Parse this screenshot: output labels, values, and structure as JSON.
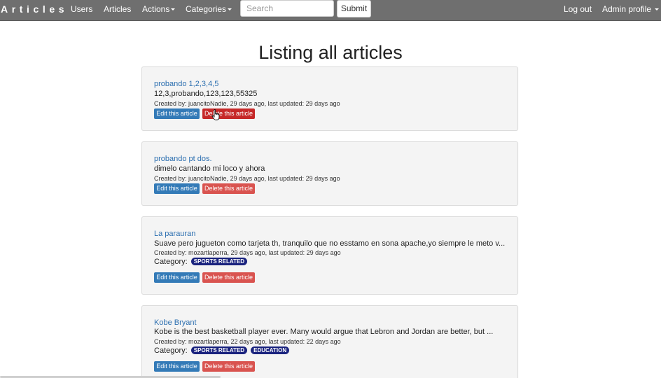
{
  "navbar": {
    "brand": "Articles",
    "links": {
      "users": "Users",
      "articles": "Articles",
      "actions": "Actions",
      "categories": "Categories",
      "logout": "Log out",
      "admin_profile": "Admin profile"
    },
    "search": {
      "placeholder": "Search",
      "value": ""
    },
    "submit_label": "Submit"
  },
  "page": {
    "title": "Listing all articles"
  },
  "labels": {
    "edit": "Edit this article",
    "delete": "Delete this article",
    "category": "Category:"
  },
  "articles": [
    {
      "title": "probando 1,2,3,4,5",
      "description": "12,3,probando,123,123,55325",
      "meta": "Created by: juancitoNadie, 29 days ago, last updated: 29 days ago",
      "categories": []
    },
    {
      "title": "probando pt dos.",
      "description": "dimelo cantando mi loco y ahora",
      "meta": "Created by: juancitoNadie, 29 days ago, last updated: 29 days ago",
      "categories": []
    },
    {
      "title": "La parauran",
      "description": "Suave pero jugueton como tarjeta th, tranquilo que no esstamo en sona apache,yo siempre le meto v...",
      "meta": "Created by: mozartlaperra, 29 days ago, last updated: 29 days ago",
      "categories": [
        "SPORTS RELATED"
      ]
    },
    {
      "title": "Kobe Bryant",
      "description": "Kobe is the best basketball player ever. Many would argue that Lebron and Jordan are better, but ...",
      "meta": "Created by: mozartlaperra, 22 days ago, last updated: 22 days ago",
      "categories": [
        "SPORTS RELATED",
        "EDUCATION"
      ]
    }
  ],
  "colors": {
    "navbar": "#6f6f6f",
    "link": "#2c6fb0",
    "edit_button": "#337ab7",
    "delete_button": "#d9534f",
    "badge": "#1a237e"
  },
  "icons": {
    "caret": "caret-down-icon",
    "cursor": "mouse-pointer-icon"
  }
}
